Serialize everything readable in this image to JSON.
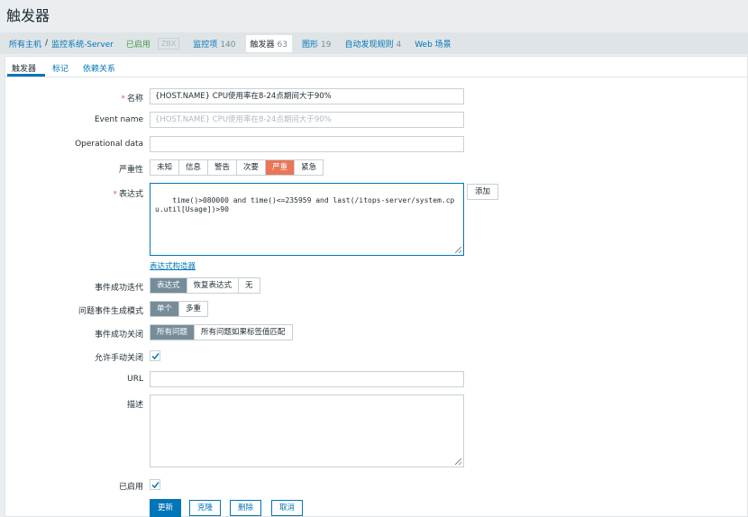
{
  "page": {
    "title": "触发器"
  },
  "hostbar": {
    "all_hosts": "所有主机",
    "separator": "/",
    "host": "监控系统-Server",
    "status": "已启用",
    "zbx": "ZBX",
    "items": {
      "label": "监控项",
      "count": "140"
    },
    "triggers": {
      "label": "触发器",
      "count": "63"
    },
    "graphs": {
      "label": "图形",
      "count": "19"
    },
    "discovery": {
      "label": "自动发现规则",
      "count": "4"
    },
    "web": {
      "label": "Web 场景"
    }
  },
  "tabs": [
    "触发器",
    "标记",
    "依赖关系"
  ],
  "form": {
    "name": {
      "label": "名称",
      "required_mark": "*",
      "value": "{HOST.NAME} CPU使用率在8-24点期间大于90%"
    },
    "event_name": {
      "label": "Event name",
      "placeholder": "{HOST.NAME} CPU使用率在8-24点期间大于90%"
    },
    "operational_data": {
      "label": "Operational data",
      "value": ""
    },
    "severity": {
      "label": "严重性",
      "options": [
        "未知",
        "信息",
        "警告",
        "次要",
        "严重",
        "紧急"
      ],
      "selected": "严重",
      "selected_color": "#e97659"
    },
    "expression": {
      "label": "表达式",
      "required_mark": "*",
      "value": "time()>080000 and time()<=235959 and last(/itops-server/system.cpu.util[Usage])>90",
      "add_button": "添加",
      "constructor_link": "表达式构造器"
    },
    "ok_event_generation": {
      "label": "事件成功迭代",
      "options": [
        "表达式",
        "恢复表达式",
        "无"
      ],
      "selected": "表达式"
    },
    "problem_event_mode": {
      "label": "问题事件生成模式",
      "options": [
        "单个",
        "多重"
      ],
      "selected": "单个"
    },
    "ok_event_closes": {
      "label": "事件成功关闭",
      "options": [
        "所有问题",
        "所有问题如果标签值匹配"
      ],
      "selected": "所有问题"
    },
    "allow_manual_close": {
      "label": "允许手动关闭",
      "checked": true
    },
    "url": {
      "label": "URL",
      "value": ""
    },
    "description": {
      "label": "描述",
      "value": ""
    },
    "enabled": {
      "label": "已启用",
      "checked": true
    }
  },
  "buttons": {
    "update": "更新",
    "clone": "克隆",
    "delete": "删除",
    "cancel": "取消"
  },
  "colors": {
    "link": "#0275b8",
    "primary": "#0275b8",
    "enabled_green": "#429e47",
    "required_red": "#e45959"
  }
}
